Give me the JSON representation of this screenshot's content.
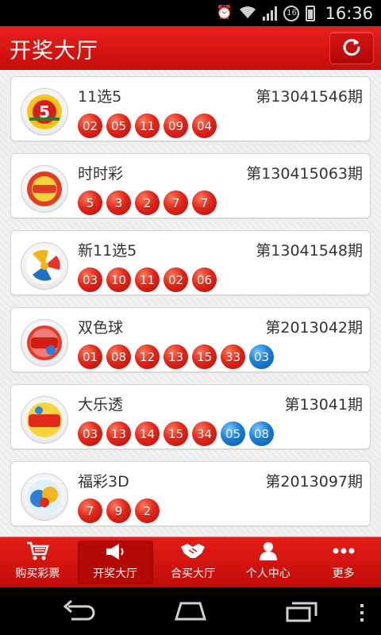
{
  "status_bar": {
    "time": "16:36",
    "badge": "16"
  },
  "header": {
    "title": "开奖大厅"
  },
  "lotteries": [
    {
      "name": "11选5",
      "issue": "第13041546期",
      "logo": "11xuan5-logo",
      "balls": [
        {
          "n": "02",
          "c": "red"
        },
        {
          "n": "05",
          "c": "red"
        },
        {
          "n": "11",
          "c": "red"
        },
        {
          "n": "09",
          "c": "red"
        },
        {
          "n": "04",
          "c": "red"
        }
      ]
    },
    {
      "name": "时时彩",
      "issue": "第130415063期",
      "logo": "shishicai-logo",
      "balls": [
        {
          "n": "5",
          "c": "red"
        },
        {
          "n": "3",
          "c": "red"
        },
        {
          "n": "2",
          "c": "red"
        },
        {
          "n": "7",
          "c": "red"
        },
        {
          "n": "7",
          "c": "red"
        }
      ]
    },
    {
      "name": "新11选5",
      "issue": "第13041548期",
      "logo": "xin11xuan5-logo",
      "balls": [
        {
          "n": "03",
          "c": "red"
        },
        {
          "n": "10",
          "c": "red"
        },
        {
          "n": "11",
          "c": "red"
        },
        {
          "n": "02",
          "c": "red"
        },
        {
          "n": "06",
          "c": "red"
        }
      ]
    },
    {
      "name": "双色球",
      "issue": "第2013042期",
      "logo": "shuangseqiu-logo",
      "balls": [
        {
          "n": "01",
          "c": "red"
        },
        {
          "n": "08",
          "c": "red"
        },
        {
          "n": "12",
          "c": "red"
        },
        {
          "n": "13",
          "c": "red"
        },
        {
          "n": "15",
          "c": "red"
        },
        {
          "n": "33",
          "c": "red"
        },
        {
          "n": "03",
          "c": "blue"
        }
      ]
    },
    {
      "name": "大乐透",
      "issue": "第13041期",
      "logo": "daletou-logo",
      "balls": [
        {
          "n": "03",
          "c": "red"
        },
        {
          "n": "13",
          "c": "red"
        },
        {
          "n": "14",
          "c": "red"
        },
        {
          "n": "15",
          "c": "red"
        },
        {
          "n": "34",
          "c": "red"
        },
        {
          "n": "05",
          "c": "blue"
        },
        {
          "n": "08",
          "c": "blue"
        }
      ]
    },
    {
      "name": "福彩3D",
      "issue": "第2013097期",
      "logo": "fucai3d-logo",
      "balls": [
        {
          "n": "7",
          "c": "red"
        },
        {
          "n": "9",
          "c": "red"
        },
        {
          "n": "2",
          "c": "red"
        }
      ]
    }
  ],
  "bottom_nav": [
    {
      "label": "购买彩票",
      "icon": "cart-icon",
      "active": false
    },
    {
      "label": "开奖大厅",
      "icon": "megaphone-icon",
      "active": true
    },
    {
      "label": "合买大厅",
      "icon": "handshake-icon",
      "active": false
    },
    {
      "label": "个人中心",
      "icon": "person-icon",
      "active": false
    },
    {
      "label": "更多",
      "icon": "more-dots-icon",
      "active": false
    }
  ],
  "colors": {
    "brand_red": "#d3120f",
    "ball_red": "#e2261a",
    "ball_blue": "#1a7fd8"
  }
}
